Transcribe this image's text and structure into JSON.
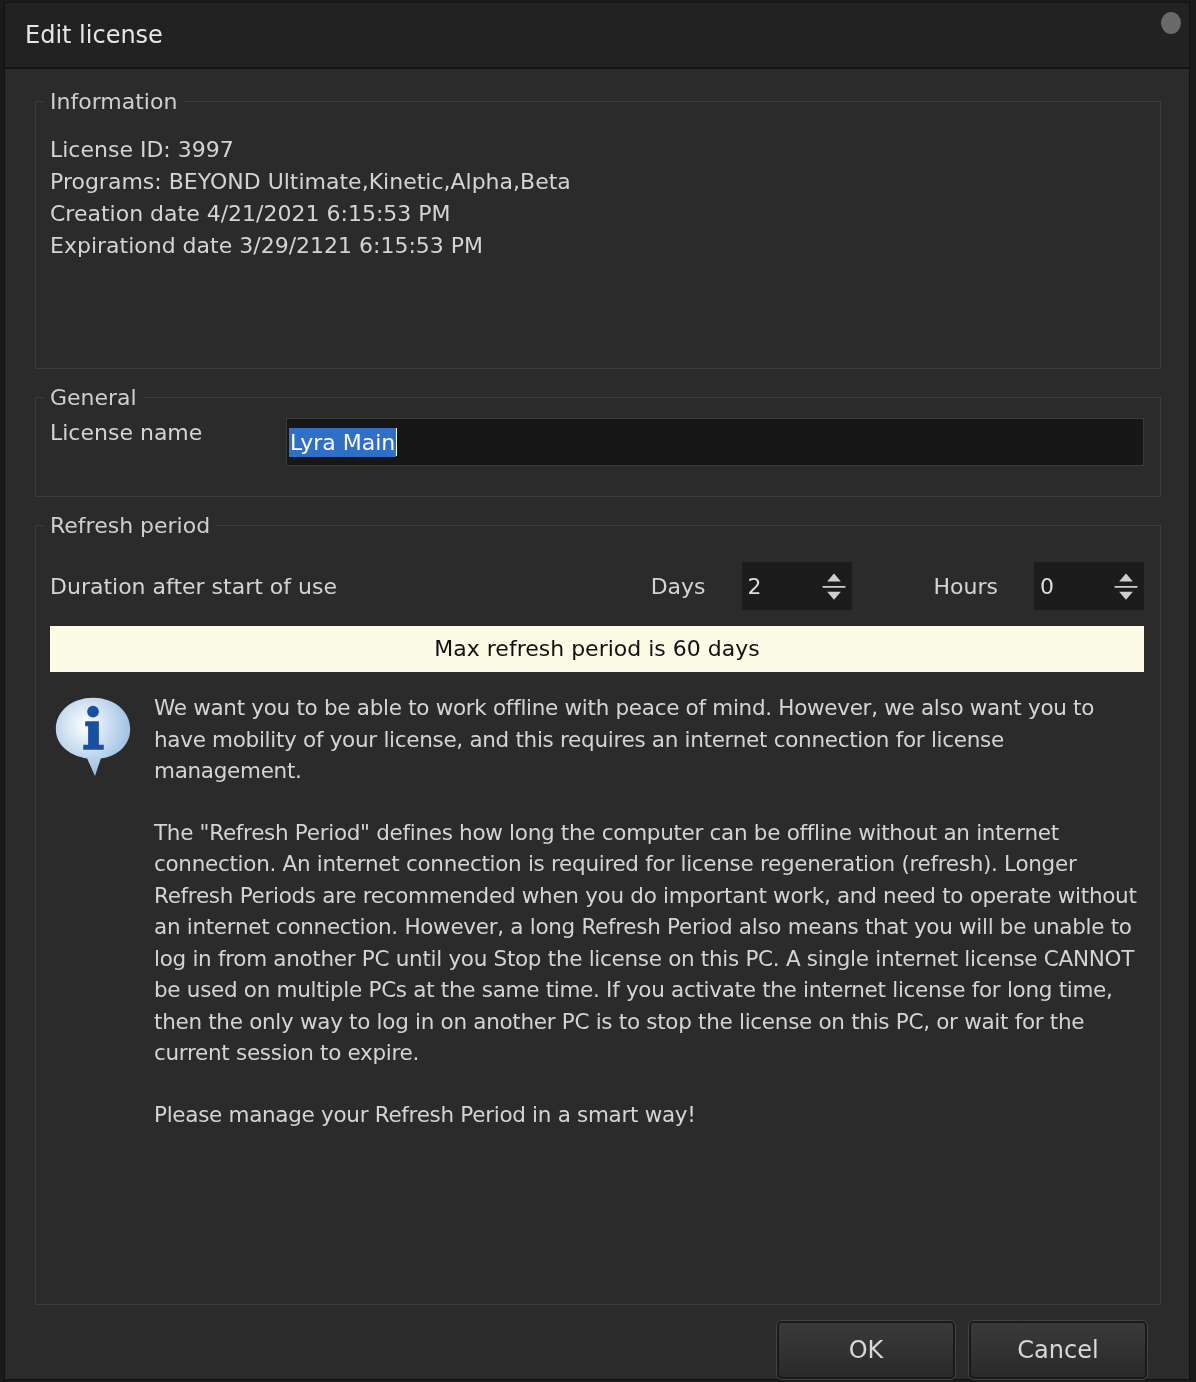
{
  "window": {
    "title": "Edit license"
  },
  "information": {
    "title": "Information",
    "lines": [
      "License ID: 3997",
      "Programs: BEYOND Ultimate,Kinetic,Alpha,Beta",
      "Creation date 4/21/2021 6:15:53 PM",
      "Expirationd date 3/29/2121 6:15:53 PM"
    ]
  },
  "general": {
    "title": "General",
    "license_name": {
      "label": "License name",
      "value": "Lyra Main",
      "selected": true
    }
  },
  "refresh_period": {
    "title": "Refresh period",
    "duration_label": "Duration after start of use",
    "spinners": [
      {
        "label": "Days",
        "value": "2"
      },
      {
        "label": "Hours",
        "value": "0"
      }
    ],
    "notice": "Max refresh period is 60 days",
    "paragraphs": [
      "We want you to be able to work offline with peace of mind. However, we also want you to have mobility of your license, and this requires an internet connection for license management.",
      "The \"Refresh Period\" defines how long the computer can be offline without an internet connection. An internet connection is required for license regeneration (refresh). Longer Refresh Periods are recommended when you do important work, and need to operate without an internet connection. However, a long Refresh Period also means that you will be unable to log in from another PC until you Stop the license on this PC. A single internet license CANNOT be used on multiple PCs at the same time. If you activate the internet license for long time, then the only way to log in on another PC is to stop the license on this PC, or wait for the current session to expire.",
      "Please manage your Refresh Period in a smart way!"
    ]
  },
  "buttons": [
    "OK",
    "Cancel"
  ]
}
